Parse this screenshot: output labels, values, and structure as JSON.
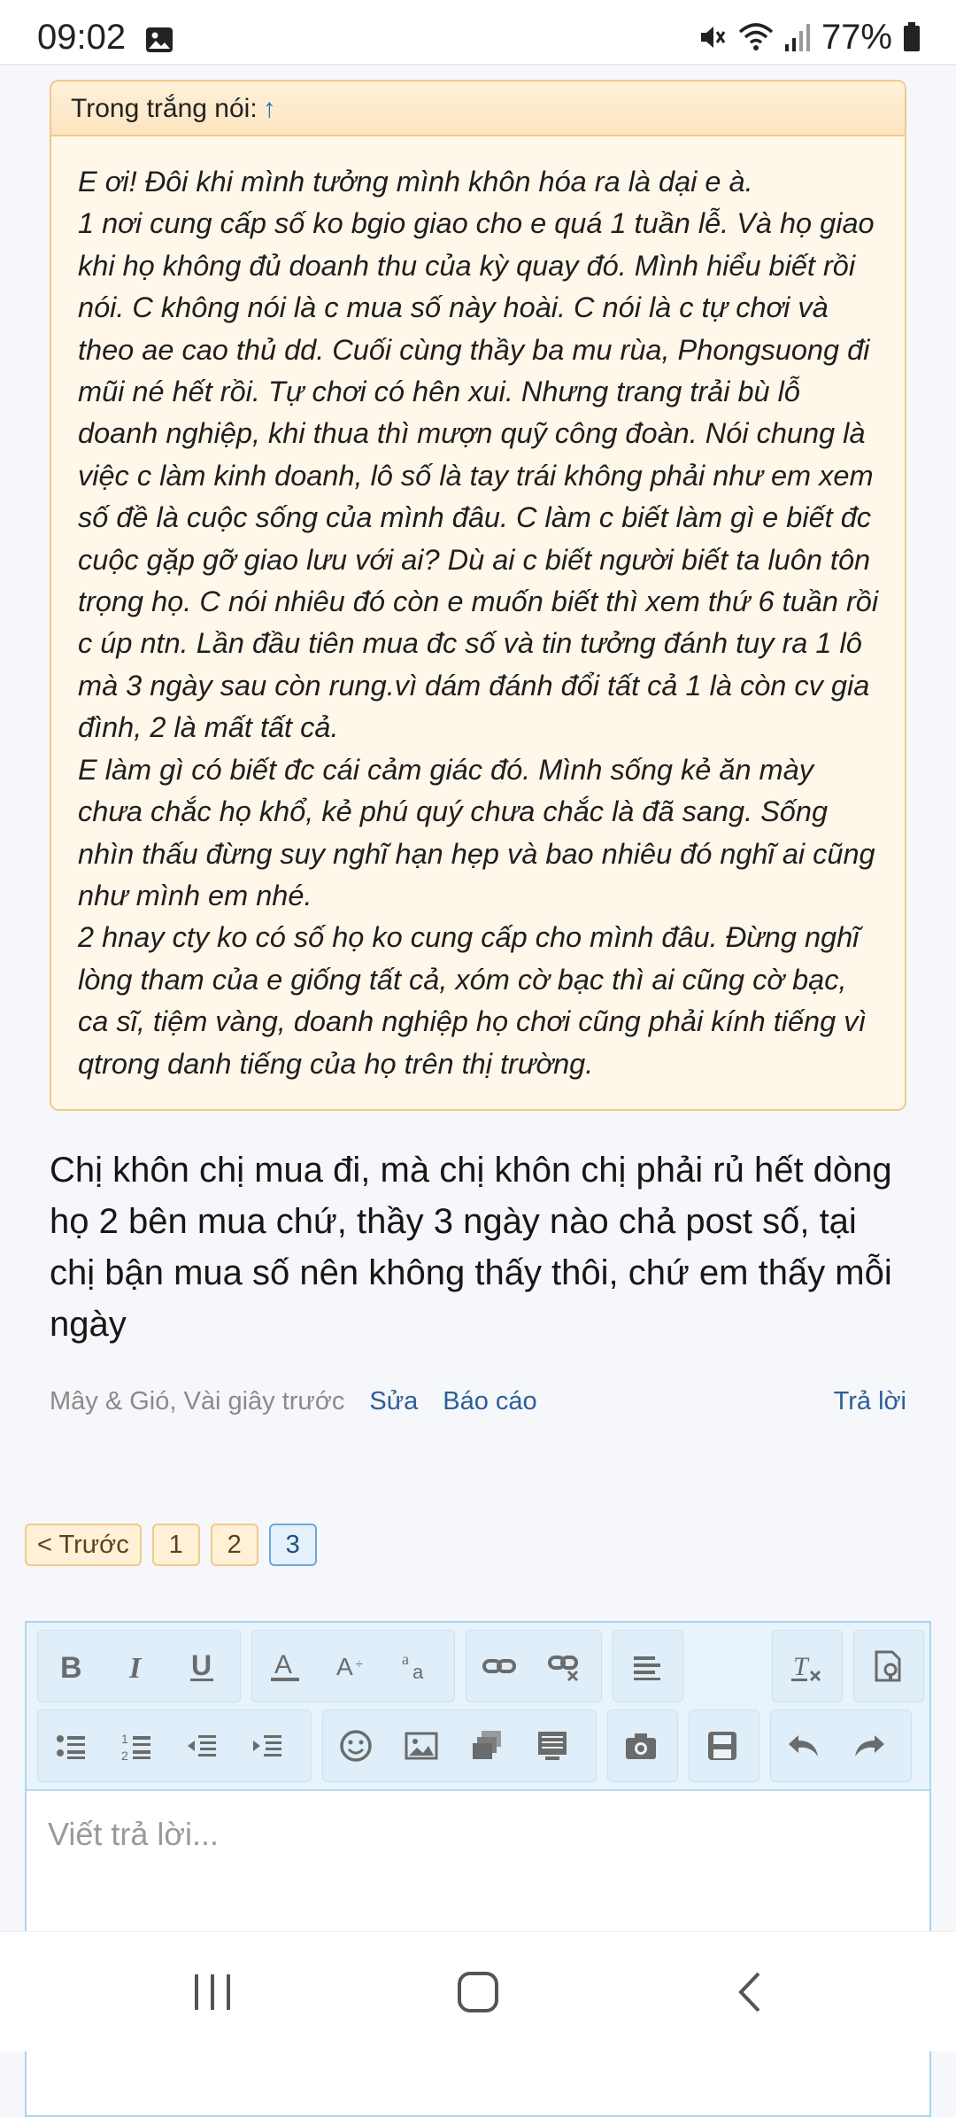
{
  "status_bar": {
    "time": "09:02",
    "battery": "77%",
    "icons": [
      "gallery-icon",
      "mute-icon",
      "wifi-icon",
      "signal-icon",
      "battery-icon"
    ]
  },
  "quote": {
    "header_label": "Trong trắng nói:",
    "header_arrow": "↑",
    "paragraphs": [
      "E ơi! Đôi khi mình tưởng mình khôn hóa ra là dại e à.",
      "1 nơi cung cấp số ko bgio giao cho e quá 1 tuần lễ. Và họ giao khi họ không đủ doanh thu của kỳ quay đó. Mình hiểu biết rồi nói. C không nói là c mua số này hoài. C nói là c tự chơi và theo ae cao thủ dd. Cuối cùng thầy ba mu rùa, Phongsuong đi mũi né hết rồi. Tự chơi có hên xui. Nhưng trang trải bù lỗ doanh nghiệp, khi thua thì mượn quỹ công đoàn. Nói chung là việc c làm kinh doanh, lô số là tay trái không phải như em xem số đề là cuộc sống của mình đâu. C làm c biết làm gì e biết đc cuộc gặp gỡ giao lưu với ai? Dù ai c biết người biết ta luôn tôn trọng họ. C nói nhiêu đó còn e muốn biết thì xem thứ 6 tuần rồi c úp ntn. Lần đầu tiên mua đc số và tin tưởng đánh tuy ra 1 lô mà 3 ngày sau còn rung.vì dám đánh đổi tất cả 1 là còn cv gia đình, 2 là mất tất cả.",
      "E làm gì có biết đc cái cảm giác đó. Mình sống kẻ ăn mày chưa chắc họ khổ, kẻ phú quý chưa chắc là đã sang. Sống nhìn thấu đừng suy nghĩ hạn hẹp và bao nhiêu đó nghĩ ai cũng như mình em nhé.",
      "2 hnay cty ko có số họ ko cung cấp cho mình đâu. Đừng nghĩ lòng tham của e giống tất cả, xóm cờ bạc thì ai cũng cờ bạc, ca sĩ, tiệm vàng, doanh nghiệp họ chơi cũng phải kính tiếng vì qtrong danh tiếng của họ trên thị trường."
    ]
  },
  "post": {
    "text": "Chị khôn chị mua đi, mà chị khôn chị phải rủ hết dòng họ 2 bên mua chứ, thầy 3 ngày nào chả post số, tại chị bận mua số nên không thấy thôi, chứ em thấy mỗi ngày",
    "author_time": "Mây & Gió, Vài giây trước",
    "edit_label": "Sửa",
    "report_label": "Báo cáo",
    "reply_label": "Trả lời"
  },
  "pagination": {
    "prev_label": "< Trước",
    "pages": [
      "1",
      "2",
      "3"
    ],
    "current": "3"
  },
  "editor": {
    "placeholder": "Viết trả lời...",
    "toolbar_icons": [
      "bold-icon",
      "italic-icon",
      "underline-icon",
      "font-color-icon",
      "font-size-icon",
      "font-family-icon",
      "link-icon",
      "unlink-icon",
      "align-icon",
      "clear-format-icon",
      "toggle-bbcode-icon",
      "bullet-list-icon",
      "numbered-list-icon",
      "outdent-icon",
      "indent-icon",
      "smilie-icon",
      "image-icon",
      "media-icon",
      "quote-insert-icon",
      "camera-icon",
      "save-draft-icon",
      "undo-icon",
      "redo-icon"
    ]
  },
  "colors": {
    "quote_bg": "#fff7ea",
    "quote_border": "#f1c98a",
    "link": "#2c5f99",
    "toolbar_bg": "#e8f3fb"
  }
}
